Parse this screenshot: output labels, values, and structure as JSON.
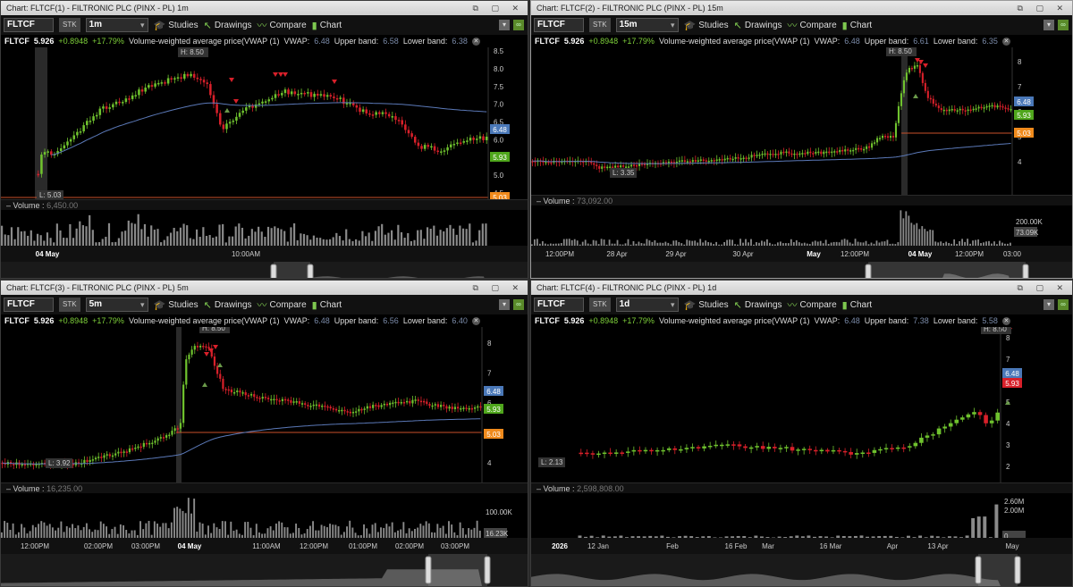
{
  "panels": [
    {
      "title": "Chart: FLTCF(1) - FILTRONIC PLC (PINX - PL) 1m",
      "interval": "1m",
      "vwap": "6.48",
      "upper": "6.58",
      "lower": "6.38",
      "volume_value": "6,450.00",
      "price_ticks": [
        "8.5",
        "8.0",
        "7.5",
        "7.0",
        "6.5",
        "6.0",
        "5.5",
        "5.0",
        "4.5"
      ],
      "badges": {
        "vwap": "6.48",
        "last": "5.93",
        "low_line": "5.03"
      },
      "high_label": "H: 8.50",
      "low_label": "L: 5.03",
      "vol_ticks": [
        "6.45K"
      ],
      "x_labels": [
        "04 May",
        "10:00AM"
      ]
    },
    {
      "title": "Chart: FLTCF(2) - FILTRONIC PLC (PINX - PL) 15m",
      "interval": "15m",
      "vwap": "6.48",
      "upper": "6.61",
      "lower": "6.35",
      "volume_value": "73,092.00",
      "price_ticks": [
        "8",
        "7",
        "6",
        "5",
        "4"
      ],
      "badges": {
        "vwap": "6.48",
        "last": "5.93",
        "low_line": "5.03"
      },
      "high_label": "H: 8.50",
      "low_label": "L: 3.35",
      "vol_ticks": [
        "200.00K",
        "73.09K"
      ],
      "x_labels": [
        "12:00PM",
        "28 Apr",
        "29 Apr",
        "30 Apr",
        "May",
        "12:00PM",
        "04 May",
        "12:00PM",
        "03:00"
      ]
    },
    {
      "title": "Chart: FLTCF(3) - FILTRONIC PLC (PINX - PL) 5m",
      "interval": "5m",
      "vwap": "6.48",
      "upper": "6.56",
      "lower": "6.40",
      "volume_value": "16,235.00",
      "price_ticks": [
        "8",
        "7",
        "6",
        "5",
        "4"
      ],
      "badges": {
        "vwap": "6.48",
        "last": "5.93",
        "low_line": "5.03"
      },
      "high_label": "H: 8.50",
      "low_label": "L: 3.92",
      "vol_ticks": [
        "100.00K",
        "16.23K"
      ],
      "x_labels": [
        "12:00PM",
        "02:00PM",
        "03:00PM",
        "04 May",
        "11:00AM",
        "12:00PM",
        "01:00PM",
        "02:00PM",
        "03:00PM"
      ]
    },
    {
      "title": "Chart: FLTCF(4) - FILTRONIC PLC (PINX - PL) 1d",
      "interval": "1d",
      "vwap": "6.48",
      "upper": "7.38",
      "lower": "5.58",
      "volume_value": "2,598,808.00",
      "price_ticks": [
        "8",
        "7",
        "6",
        "5",
        "4",
        "3",
        "2"
      ],
      "badges": {
        "vwap": "6.48",
        "last": "5.93"
      },
      "high_label": "H: 8.50",
      "low_label": "L: 2.13",
      "vol_ticks": [
        "2.60M",
        "2.00M",
        "0"
      ],
      "x_labels": [
        "2026",
        "12 Jan",
        "Feb",
        "16 Feb",
        "Mar",
        "16 Mar",
        "Apr",
        "13 Apr",
        "May"
      ]
    }
  ],
  "common": {
    "symbol": "FLTCF",
    "stk": "STK",
    "price": "5.926",
    "change": "+0.8948",
    "pct": "+17.79%",
    "study": "Volume-weighted average price(VWAP (1)",
    "vwap_lbl": "VWAP:",
    "upper_lbl": "Upper band:",
    "lower_lbl": "Lower band:",
    "studies": "Studies",
    "drawings": "Drawings",
    "compare": "Compare",
    "chart": "Chart",
    "volume_lbl": "Volume"
  },
  "colors": {
    "up": "#6fc22e",
    "down": "#d8202a",
    "vwap": "#5b79b8",
    "low_line": "#c8502a",
    "badge_blue": "#4a78b8",
    "badge_green": "#4fa61c",
    "badge_orange": "#f08a1c",
    "badge_red": "#d8202a"
  }
}
